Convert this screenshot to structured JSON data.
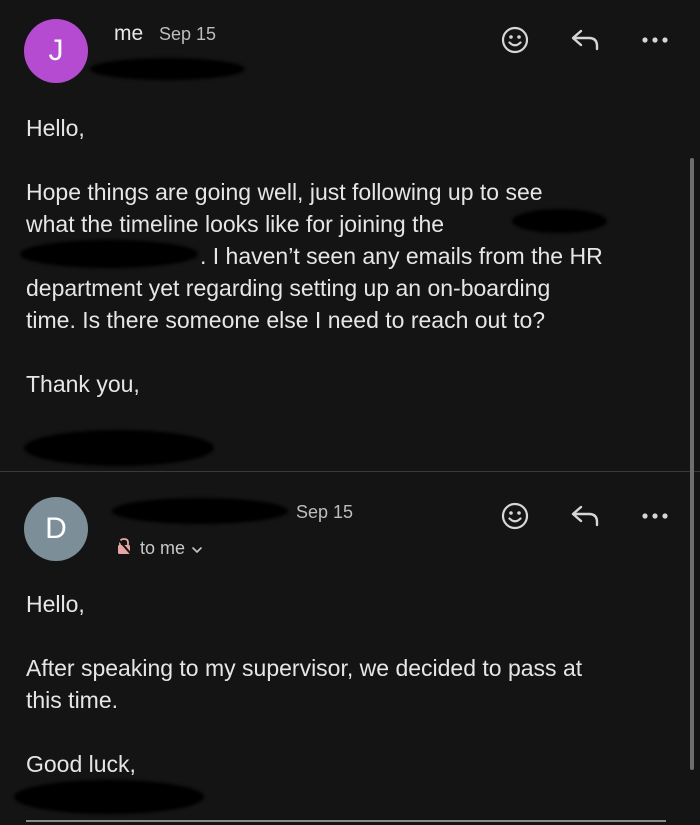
{
  "messages": [
    {
      "avatar_letter": "J",
      "avatar_color": "#b54bd0",
      "sender": "me",
      "date": "Sep 15",
      "body": {
        "greeting": "Hello,",
        "line1": "Hope things are going well, just following up to see",
        "line2": "what the timeline looks like for joining the",
        "line3": ". I haven’t seen any emails from the HR",
        "line4": "department yet regarding setting up an on-boarding",
        "line5": "time. Is there someone else I need to reach out to?",
        "closing": "Thank you,"
      }
    },
    {
      "avatar_letter": "D",
      "avatar_color": "#7c8f99",
      "sender": "",
      "date": "Sep 15",
      "recipient_label": "to me",
      "body": {
        "greeting": "Hello,",
        "line1": "After speaking to my supervisor, we decided to pass at",
        "line2": "this time.",
        "closing": "Good luck,"
      }
    }
  ],
  "icons": {
    "react": "smiley-icon",
    "reply": "reply-arrow-icon",
    "more": "more-dots-icon",
    "lock": "lock-icon",
    "chevron": "chevron-down-icon"
  }
}
